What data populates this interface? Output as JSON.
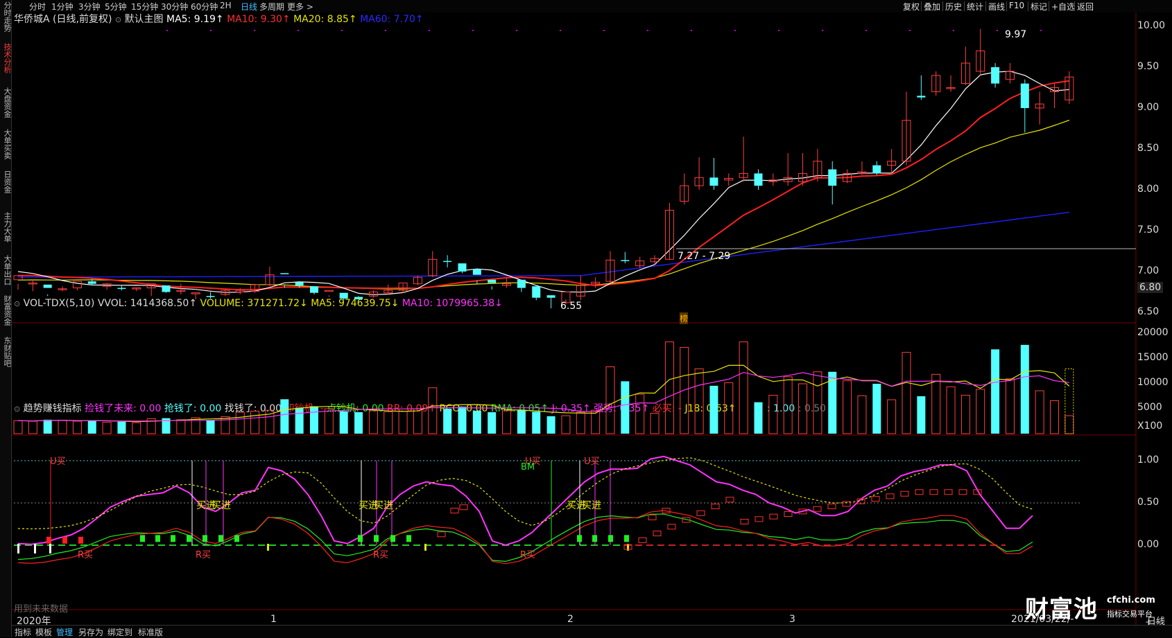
{
  "sidebar": {
    "items": [
      "分时走势",
      "技术分析",
      "大盘资金",
      "大单买卖",
      "日资金",
      "主力大单",
      "大单出口",
      "财富资金",
      "东财贴吧"
    ],
    "active_index": 1
  },
  "periods": [
    "分时",
    "1分钟",
    "3分钟",
    "5分钟",
    "15分钟",
    "30分钟",
    "60分钟",
    "2H",
    "日线",
    "多周期",
    "更多 >"
  ],
  "active_period": "日线",
  "toolbar": [
    "复权",
    "叠加",
    "历史",
    "统计",
    "画线",
    "F10",
    "标记",
    "+自选",
    "返回"
  ],
  "main_legend": {
    "stock_name": "华侨城A (日线,前复权)",
    "template": "默认主图",
    "ma5": "MA5: 9.19↑",
    "ma10": "MA10: 9.30↑",
    "ma20": "MA20: 8.85↑",
    "ma60": "MA60: 7.70↑"
  },
  "price_axis": [
    "10.00",
    "9.50",
    "9.00",
    "8.50",
    "8.00",
    "7.50",
    "7.00",
    "6.80",
    "6.50"
  ],
  "annotations": {
    "high": "9.97",
    "low": "6.55",
    "range": "7.27 - 7.29",
    "marker": "榜"
  },
  "volume_legend": {
    "name": "VOL-TDX(5,10)",
    "vvol": "VVOL: 1414368.50↑",
    "volume": "VOLUME: 371271.72↓",
    "ma5": "MA5: 974639.75↓",
    "ma10": "MA10: 1079965.38↓"
  },
  "volume_axis": [
    "20000",
    "15000",
    "10000",
    "5000",
    "X100"
  ],
  "indicator_legend": {
    "name": "趋势赚钱指标",
    "i1": "捡钱了未来: 0.00",
    "i2": "抢钱了: 0.00",
    "i3": "找钱了: 0.00",
    "i4": "印钞机: -",
    "i5": "点钞机: 0.00",
    "i6": "RR: 0.09↑",
    "i7": "RCO: 0.00",
    "i8": "RMA: 0.05↑",
    "i9": "J: 0.35↑",
    "i10": "强势: 0.35↑",
    "i11": "必买: -",
    "i12": "J18: 0.63↑",
    "i13": ": 1.00",
    "i14": ": 0.50"
  },
  "indicator_axis": [
    "1.00",
    "0.50",
    "0.00"
  ],
  "indicator_labels": {
    "u_buy": "U买",
    "r_buy": "R买",
    "buy_in": "买进",
    "bm": "BM",
    "future_data": "用到未来数据"
  },
  "time_axis": {
    "year": "2020年",
    "months": [
      "1",
      "2",
      "3"
    ],
    "date": "2021/03/22/-"
  },
  "bottom_tabs": [
    "指标",
    "模板",
    "管理",
    "另存为",
    "绑定到",
    "标准版"
  ],
  "bottom_right": "日线",
  "watermark": {
    "cn": "财富池",
    "site": "cfchi.com",
    "sub": "指标交易平台"
  },
  "colors": {
    "up": "#ff4040",
    "down": "#54ffff",
    "ma5": "#ffffff",
    "ma10": "#ff2020",
    "ma20": "#e6e600",
    "ma60": "#2020ff",
    "magenta": "#ff33ff"
  },
  "chart_data": {
    "type": "candlestick",
    "title": "华侨城A (日线,前复权)",
    "price_ylim": [
      6.4,
      10.1
    ],
    "candles": [
      [
        6.9,
        6.95,
        6.85,
        6.78
      ],
      [
        6.85,
        6.86,
        6.9,
        6.76
      ],
      [
        6.84,
        6.8,
        6.72,
        6.7
      ],
      [
        6.79,
        6.79,
        6.82,
        6.76
      ],
      [
        6.8,
        6.88,
        6.8,
        6.77
      ],
      [
        6.88,
        6.85,
        6.91,
        6.83
      ],
      [
        6.82,
        6.85,
        6.86,
        6.78
      ],
      [
        6.8,
        6.79,
        6.83,
        6.77
      ],
      [
        6.79,
        6.8,
        6.8,
        6.76
      ],
      [
        6.8,
        6.85,
        6.83,
        6.7
      ],
      [
        6.83,
        6.75,
        6.8,
        6.74
      ],
      [
        6.76,
        6.77,
        6.85,
        6.72
      ],
      [
        6.74,
        6.74,
        6.72,
        6.66
      ],
      [
        6.7,
        6.69,
        6.75,
        6.67
      ],
      [
        6.72,
        6.77,
        6.78,
        6.7
      ],
      [
        6.75,
        6.77,
        6.8,
        6.72
      ],
      [
        6.76,
        6.84,
        6.85,
        6.74
      ],
      [
        6.84,
        6.96,
        7.06,
        6.82
      ],
      [
        6.98,
        6.97,
        6.84,
        6.8
      ],
      [
        6.87,
        6.83,
        6.88,
        6.8
      ],
      [
        6.82,
        6.74,
        6.79,
        6.72
      ],
      [
        6.76,
        6.77,
        6.71,
        6.69
      ],
      [
        6.74,
        6.67,
        6.7,
        6.65
      ],
      [
        6.69,
        6.66,
        6.7,
        6.68
      ],
      [
        6.7,
        6.75,
        6.77,
        6.68
      ],
      [
        6.74,
        6.77,
        6.84,
        6.72
      ],
      [
        6.77,
        6.86,
        6.85,
        6.74
      ],
      [
        6.85,
        6.93,
        6.95,
        6.83
      ],
      [
        6.95,
        7.15,
        7.25,
        6.93
      ],
      [
        7.13,
        7.12,
        7.2,
        7.05
      ],
      [
        7.1,
        7.0,
        7.07,
        6.98
      ],
      [
        7.03,
        6.96,
        6.89,
        6.85
      ],
      [
        6.9,
        6.86,
        6.82,
        6.78
      ],
      [
        6.83,
        6.85,
        6.92,
        6.8
      ],
      [
        6.9,
        6.8,
        6.88,
        6.75
      ],
      [
        6.82,
        6.68,
        6.79,
        6.65
      ],
      [
        6.71,
        6.68,
        6.7,
        6.55
      ],
      [
        6.62,
        6.75,
        6.66,
        6.6
      ],
      [
        6.7,
        6.83,
        6.95,
        6.65
      ],
      [
        6.85,
        6.87,
        6.93,
        6.8
      ],
      [
        6.88,
        7.14,
        7.25,
        6.86
      ],
      [
        7.14,
        7.13,
        7.24,
        7.1
      ],
      [
        7.07,
        7.13,
        7.18,
        7.04
      ],
      [
        7.12,
        7.16,
        7.2,
        7.1
      ],
      [
        7.15,
        7.75,
        7.84,
        7.14
      ],
      [
        7.86,
        8.05,
        8.2,
        7.82
      ],
      [
        8.05,
        8.15,
        8.4,
        8.0
      ],
      [
        8.15,
        8.05,
        8.39,
        8.0
      ],
      [
        8.12,
        8.14,
        8.2,
        8.05
      ],
      [
        8.15,
        8.2,
        8.65,
        8.1
      ],
      [
        8.2,
        8.05,
        8.25,
        8.0
      ],
      [
        8.1,
        8.12,
        8.2,
        8.05
      ],
      [
        8.1,
        8.15,
        8.45,
        8.05
      ],
      [
        8.1,
        8.2,
        8.45,
        8.05
      ],
      [
        8.15,
        8.35,
        8.5,
        8.1
      ],
      [
        8.25,
        8.05,
        8.35,
        7.82
      ],
      [
        8.1,
        8.2,
        8.25,
        8.08
      ],
      [
        8.2,
        8.22,
        8.35,
        8.18
      ],
      [
        8.3,
        8.2,
        8.35,
        8.18
      ],
      [
        8.3,
        8.35,
        8.5,
        8.2
      ],
      [
        8.35,
        8.85,
        9.2,
        8.3
      ],
      [
        9.15,
        9.13,
        9.4,
        9.1
      ],
      [
        9.2,
        9.4,
        9.45,
        9.15
      ],
      [
        9.25,
        9.25,
        9.4,
        9.2
      ],
      [
        9.3,
        9.55,
        9.75,
        9.28
      ],
      [
        9.45,
        9.7,
        9.97,
        9.4
      ],
      [
        9.5,
        9.3,
        9.55,
        9.25
      ],
      [
        9.35,
        9.45,
        9.55,
        9.3
      ],
      [
        9.3,
        9.0,
        9.35,
        8.7
      ],
      [
        9.0,
        9.05,
        9.2,
        8.8
      ],
      [
        9.2,
        9.25,
        9.3,
        9.0
      ],
      [
        9.1,
        9.38,
        9.45,
        9.05
      ]
    ]
  }
}
